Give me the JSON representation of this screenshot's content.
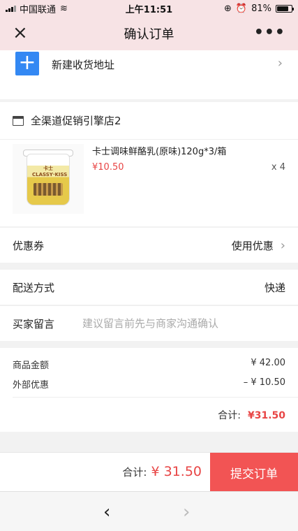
{
  "status_bar": {
    "carrier": "中国联通",
    "time": "上午11:51",
    "battery": "81%",
    "battery_level": 0.81
  },
  "nav": {
    "title": "确认订单",
    "close_icon": "×",
    "more_icon": "•••"
  },
  "address": {
    "label": "新建收货地址"
  },
  "store": {
    "name": "全渠道促销引擎店2"
  },
  "product": {
    "name": "卡士调味鲜酪乳(原味)120g*3/箱",
    "price": "¥10.50",
    "qty": "x 4",
    "image_text": "卡士 CLASSY·KISS"
  },
  "coupon": {
    "label": "优惠券",
    "value": "使用优惠"
  },
  "delivery": {
    "label": "配送方式",
    "value": "快递"
  },
  "note": {
    "label": "买家留言",
    "placeholder": "建议留言前先与商家沟通确认"
  },
  "summary": {
    "goods_label": "商品金额",
    "goods_value": "¥ 42.00",
    "discount_label": "外部优惠",
    "discount_value": "– ¥ 10.50",
    "total_label": "合计:",
    "total_value": "¥31.50"
  },
  "bottom": {
    "total_label": "合计:",
    "total_value": "¥ 31.50",
    "submit_label": "提交订单"
  },
  "browser": {
    "back": "‹",
    "forward": "›"
  },
  "colors": {
    "accent_red": "#f25454",
    "price_red": "#e84545",
    "add_blue": "#3388f3",
    "header_pink": "#f7e3e5"
  }
}
